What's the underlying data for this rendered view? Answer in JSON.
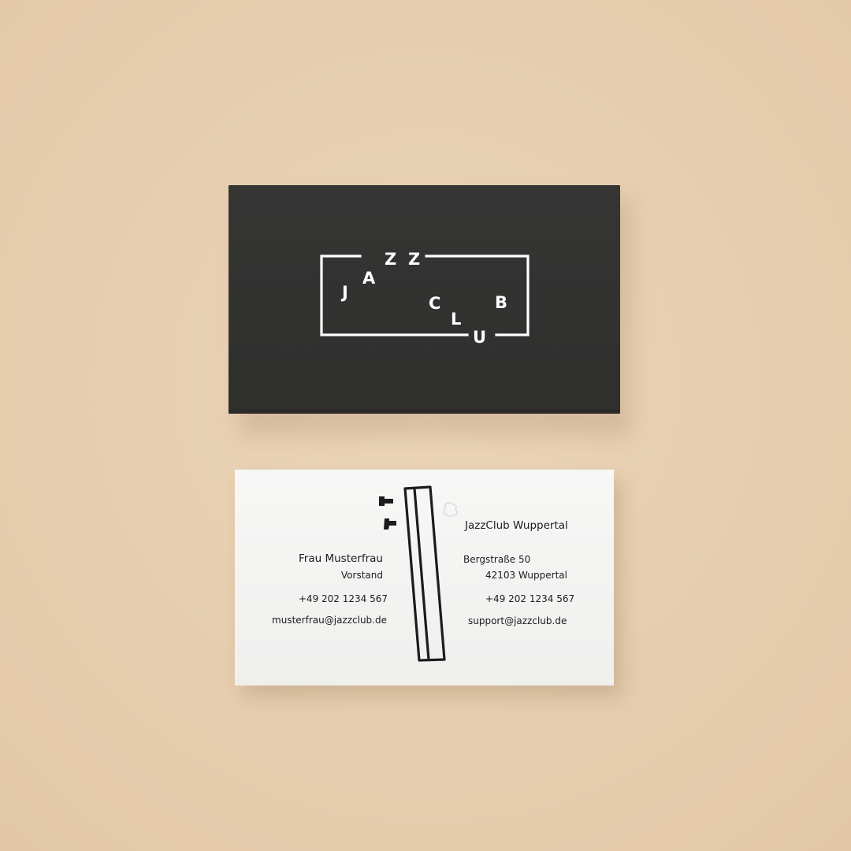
{
  "front_card": {
    "logo_letters": [
      "J",
      "A",
      "Z",
      "Z",
      "C",
      "L",
      "U",
      "B"
    ],
    "logo_name": "jazz-club-logo"
  },
  "back_card": {
    "person": {
      "name": "Frau Musterfrau",
      "role": "Vorstand",
      "phone": "+49 202 1234 567",
      "email": "musterfrau@jazzclub.de"
    },
    "club": {
      "name": "JazzClub Wuppertal",
      "street": "Bergstraße 50",
      "city": "42103 Wuppertal",
      "phone": "+49 202 1234 567",
      "email": "support@jazzclub.de"
    }
  },
  "colors": {
    "background": "#e8cfb1",
    "card_black": "#323231",
    "card_white": "#f4f4f3",
    "ink": "#1c1c1c",
    "logo_white": "#ffffff"
  }
}
